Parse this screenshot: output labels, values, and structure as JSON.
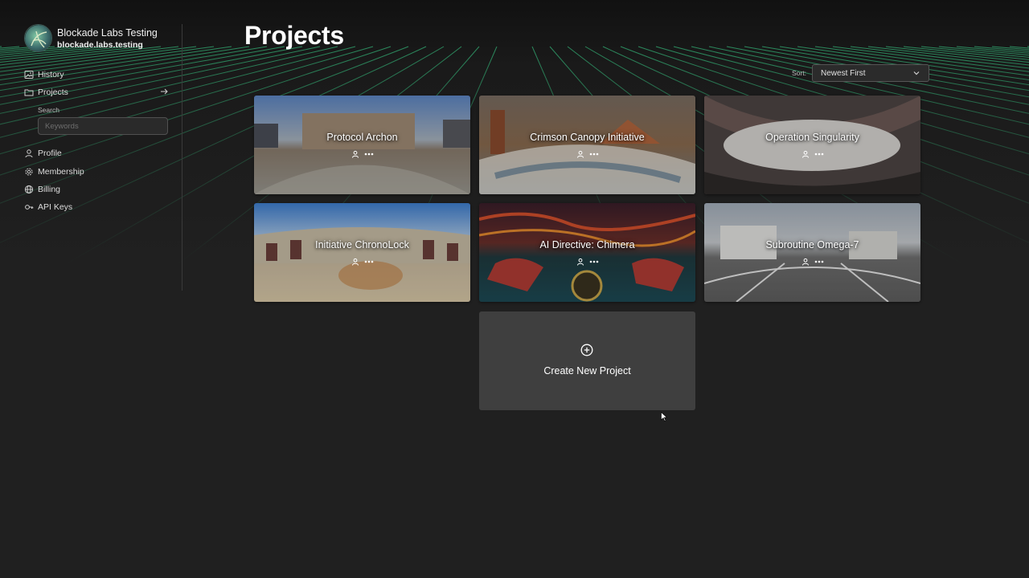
{
  "account": {
    "name": "Blockade Labs Testing",
    "handle": "blockade.labs.testing"
  },
  "sidebar": {
    "items": [
      {
        "label": "History",
        "icon": "image-icon"
      },
      {
        "label": "Projects",
        "icon": "folder-icon"
      },
      {
        "label": "Profile",
        "icon": "user-icon"
      },
      {
        "label": "Membership",
        "icon": "gear-icon"
      },
      {
        "label": "Billing",
        "icon": "globe-icon"
      },
      {
        "label": "API Keys",
        "icon": "key-icon"
      }
    ],
    "search": {
      "label": "Search",
      "placeholder": "Keywords"
    }
  },
  "header": {
    "title": "Projects",
    "sort_label": "Sort:",
    "sort_value": "Newest First"
  },
  "projects": [
    {
      "title": "Protocol Archon"
    },
    {
      "title": "Crimson Canopy Initiative"
    },
    {
      "title": "Operation Singularity"
    },
    {
      "title": "Initiative ChronoLock"
    },
    {
      "title": "AI Directive: Chimera"
    },
    {
      "title": "Subroutine Omega-7"
    }
  ],
  "create": {
    "label": "Create New Project"
  },
  "colors": {
    "background": "#202020",
    "grid": "#2f9e6a",
    "card_create": "#3f3f3f"
  }
}
